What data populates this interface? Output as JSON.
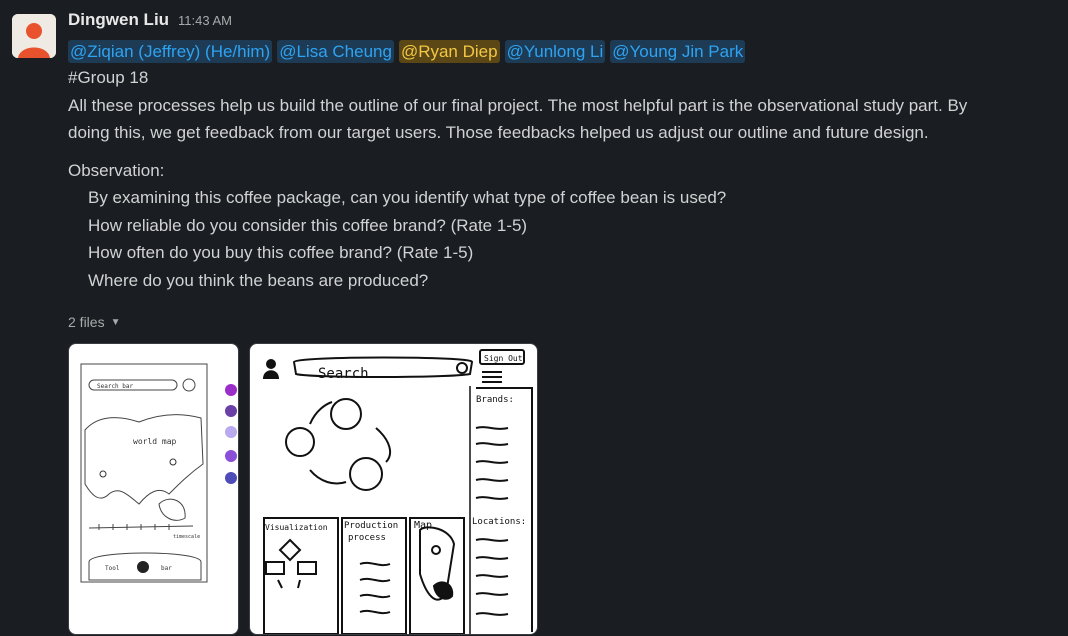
{
  "message": {
    "author": "Dingwen Liu",
    "timestamp": "11:43 AM",
    "mentions": [
      {
        "label": "@Ziqian (Jeffrey) (He/him)",
        "self": false
      },
      {
        "label": "@Lisa Cheung",
        "self": false
      },
      {
        "label": "@Ryan Diep",
        "self": true
      },
      {
        "label": "@Yunlong Li",
        "self": false
      },
      {
        "label": "@Young Jin Park",
        "self": false
      }
    ],
    "group": "#Group 18",
    "body_line1": "All these processes help us build the outline of our final project. The most helpful part is the observational study part. By",
    "body_line2": "doing this, we get feedback from our target users. Those feedbacks helped us adjust our outline and future design.",
    "observation_label": "Observation:",
    "questions": [
      "By examining this coffee package, can you identify what type of coffee bean is used?",
      "How reliable do you consider this coffee brand? (Rate 1-5)",
      "How often do you buy this coffee brand? (Rate 1-5)",
      "Where do you think the beans are produced?"
    ]
  },
  "attachments": {
    "count_label": "2 files",
    "file1": {
      "search": "Search bar",
      "map": "world map",
      "timeline": "timescale",
      "tool": "Tool",
      "bar": "bar",
      "swatches": [
        "#9a2ec9",
        "#6a3fa6",
        "#b9a9ef",
        "#8a4fd6",
        "#4e4cb8"
      ]
    },
    "file2": {
      "search": "Search",
      "signout": "Sign Out",
      "brands": "Brands:",
      "locations": "Locations:",
      "tab1": "Visualization",
      "tab2a": "Production",
      "tab2b": "process",
      "tab3": "Map"
    }
  }
}
